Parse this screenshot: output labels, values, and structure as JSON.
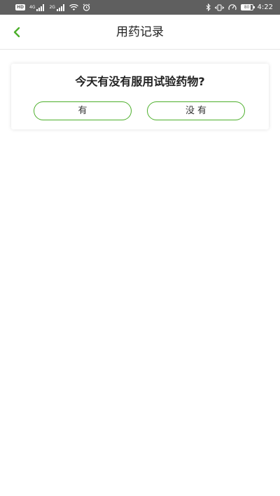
{
  "status_bar": {
    "network_label_1": "4G",
    "network_label_2": "2G",
    "battery_level": "80",
    "time": "4:22"
  },
  "nav": {
    "title": "用药记录",
    "back_icon": "chevron-left-icon"
  },
  "question_card": {
    "question": "今天有没有服用试验药物?",
    "yes_label": "有",
    "no_label": "没有"
  },
  "colors": {
    "accent": "#4caf2a",
    "status_bar_bg": "#5f5f5f"
  }
}
